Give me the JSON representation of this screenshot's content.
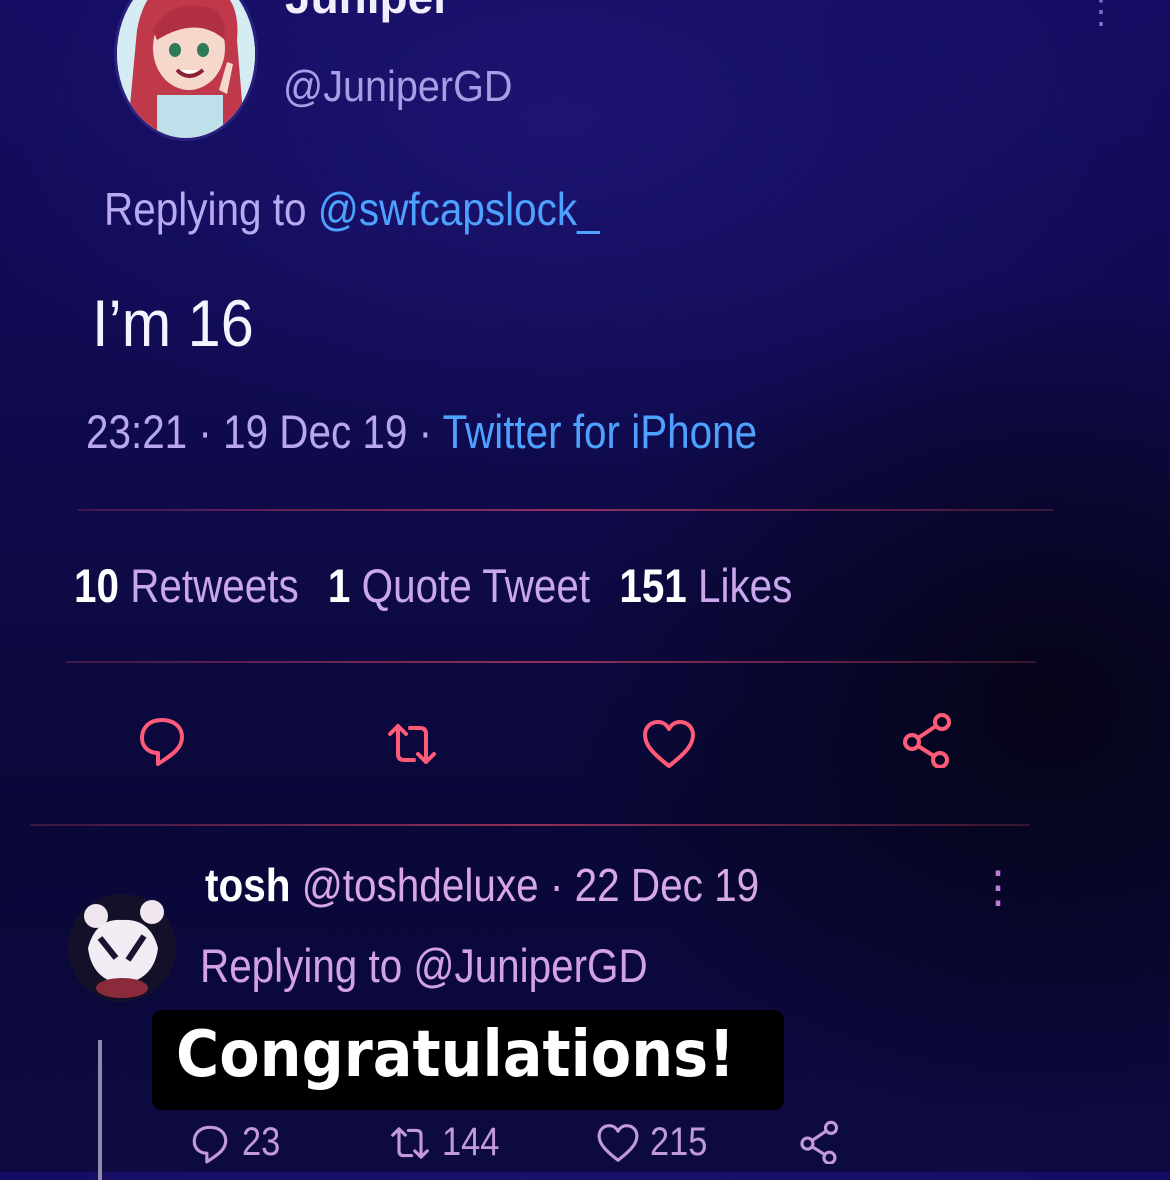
{
  "tweet": {
    "display_name": "Juniper",
    "handle": "@JuniperGD",
    "replying_prefix": "Replying to",
    "replying_to": "@swfcapslock_",
    "text": "I’m 16",
    "time": "23:21",
    "date": "19 Dec 19",
    "source": "Twitter for iPhone",
    "separator": "·",
    "stats": {
      "retweets_count": "10",
      "retweets_label": "Retweets",
      "quotes_count": "1",
      "quotes_label": "Quote Tweet",
      "likes_count": "151",
      "likes_label": "Likes"
    },
    "more_icon": "more-vertical-icon"
  },
  "reply": {
    "display_name": "tosh",
    "handle": "@toshdeluxe",
    "separator": "·",
    "date": "22 Dec 19",
    "replying_prefix": "Replying to",
    "replying_to": "@JuniperGD",
    "caption": "Congratulations!",
    "reply_count": "23",
    "retweet_count": "144",
    "like_count": "215"
  },
  "colors": {
    "link": "#4ea2ff",
    "accent_pink": "#ff5a78",
    "background_top": "#140c62"
  }
}
